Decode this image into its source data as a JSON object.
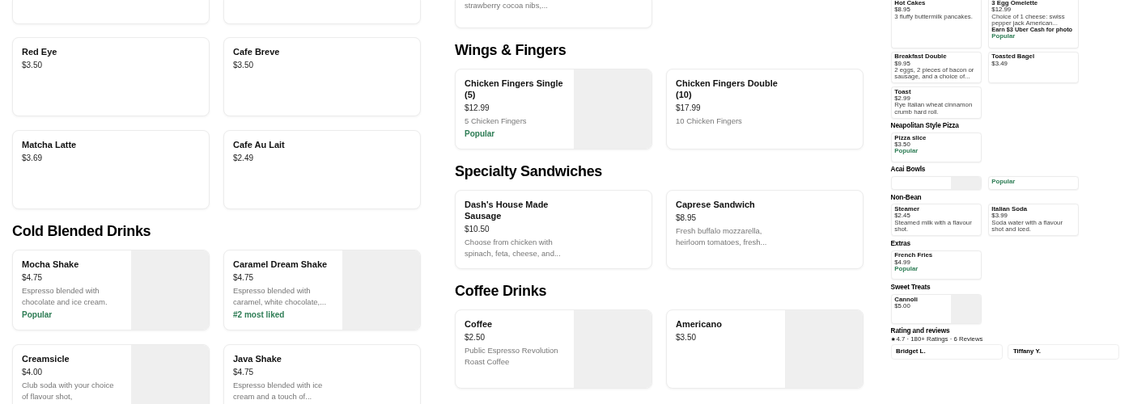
{
  "panels": [
    {
      "kind": "full",
      "blocks": [
        {
          "kind": "stub_row"
        },
        {
          "kind": "row",
          "cards": [
            {
              "name": "Red Eye",
              "price": "$3.50"
            },
            {
              "name": "Cafe Breve",
              "price": "$3.50"
            }
          ]
        },
        {
          "kind": "row",
          "cards": [
            {
              "name": "Matcha Latte",
              "price": "$3.69"
            },
            {
              "name": "Cafe Au Lait",
              "price": "$2.49"
            }
          ]
        },
        {
          "kind": "heading",
          "text": "Cold Blended Drinks"
        },
        {
          "kind": "row",
          "cards": [
            {
              "name": "Mocha Shake",
              "price": "$4.75",
              "description": "Espresso blended with chocolate and ice cream.",
              "badges": [
                {
                  "kind": "popular",
                  "text": "Popular"
                }
              ],
              "image": true
            },
            {
              "name": "Caramel Dream Shake",
              "price": "$4.75",
              "description": "Espresso blended with caramel, white chocolate,...",
              "badges": [
                {
                  "kind": "popular",
                  "text": "#2 most liked"
                }
              ],
              "image": true
            }
          ]
        },
        {
          "kind": "row",
          "cards": [
            {
              "name": "Creamsicle",
              "price": "$4.00",
              "description": "Club soda with your choice of flavour shot,",
              "image": true
            },
            {
              "name": "Java Shake",
              "price": "$4.75",
              "description": "Espresso blended with ice cream and a touch of..."
            }
          ]
        }
      ]
    },
    {
      "kind": "full",
      "blocks": [
        {
          "kind": "row",
          "cards": [
            {
              "description": "strawberry cocoa nibs,..."
            }
          ]
        },
        {
          "kind": "heading",
          "text": "Wings & Fingers"
        },
        {
          "kind": "row",
          "cards": [
            {
              "name": "Chicken Fingers Single (5)",
              "price": "$12.99",
              "description": "5 Chicken Fingers",
              "badges": [
                {
                  "kind": "popular",
                  "text": "Popular"
                }
              ],
              "image": true
            },
            {
              "name": "Chicken Fingers Double (10)",
              "price": "$17.99",
              "description": "10 Chicken Fingers"
            }
          ]
        },
        {
          "kind": "heading",
          "text": "Specialty Sandwiches"
        },
        {
          "kind": "row",
          "cards": [
            {
              "name": "Dash's House Made Sausage",
              "price": "$10.50",
              "description": "Choose from chicken with spinach, feta, cheese, and..."
            },
            {
              "name": "Caprese Sandwich",
              "price": "$8.95",
              "description": "Fresh buffalo mozzarella, heirloom tomatoes, fresh..."
            }
          ]
        },
        {
          "kind": "heading",
          "text": "Coffee Drinks"
        },
        {
          "kind": "row",
          "cards": [
            {
              "name": "Coffee",
              "price": "$2.50",
              "description": "Public Espresso Revolution Roast Coffee",
              "image": true
            },
            {
              "name": "Americano",
              "price": "$3.50",
              "image": true
            }
          ]
        }
      ]
    },
    {
      "kind": "mini",
      "blocks": [
        {
          "kind": "row",
          "cards": [
            {
              "name": "Hot Cakes",
              "price": "$8.95",
              "description": "3 fluffy buttermilk pancakes."
            },
            {
              "name": "3 Egg Omelette",
              "price": "$12.99",
              "description": "Choice of 1 cheese: swiss pepper jack American...",
              "badges": [
                {
                  "kind": "promo",
                  "text": "Earn $3 Uber Cash for photo"
                },
                {
                  "kind": "popular",
                  "text": "Popular"
                }
              ]
            }
          ]
        },
        {
          "kind": "row",
          "cards": [
            {
              "name": "Breakfast Double",
              "price": "$9.95",
              "description": "2 eggs, 2 pieces of bacon or sausage, and a choice of..."
            },
            {
              "name": "Toasted Bagel",
              "price": "$3.49"
            }
          ]
        },
        {
          "kind": "row",
          "cards": [
            {
              "name": "Toast",
              "price": "$2.99",
              "description": "Rye Italian wheat cinnamon crumb hard roll."
            }
          ]
        },
        {
          "kind": "heading",
          "text": "Neapolitan Style Pizza"
        },
        {
          "kind": "row",
          "cards": [
            {
              "name": "Pizza slice",
              "price": "$3.50",
              "badges": [
                {
                  "kind": "popular",
                  "text": "Popular"
                }
              ]
            }
          ]
        },
        {
          "kind": "heading",
          "text": "Acai Bowls"
        },
        {
          "kind": "row",
          "cards": [
            {
              "image": true
            },
            {
              "badges": [
                {
                  "kind": "popular",
                  "text": "Popular"
                }
              ]
            }
          ]
        },
        {
          "kind": "heading",
          "text": "Non-Bean"
        },
        {
          "kind": "row",
          "cards": [
            {
              "name": "Steamer",
              "price": "$2.45",
              "description": "Steamed milk with a flavour shot."
            },
            {
              "name": "Italian Soda",
              "price": "$3.99",
              "description": "Soda water with a flavour shot and iced."
            }
          ]
        },
        {
          "kind": "heading",
          "text": "Extras"
        },
        {
          "kind": "row",
          "cards": [
            {
              "name": "French Fries",
              "price": "$4.99",
              "badges": [
                {
                  "kind": "popular",
                  "text": "Popular"
                }
              ]
            }
          ]
        },
        {
          "kind": "heading",
          "text": "Sweet Treats"
        },
        {
          "kind": "row",
          "cards": [
            {
              "name": "Cannoli",
              "price": "$5.00",
              "image": true
            }
          ]
        },
        {
          "kind": "reviews",
          "heading": "Rating and reviews",
          "summary": "4.7 · 180+ Ratings · 6 Reviews",
          "reviewers": [
            "Bridget L.",
            "Tiffany Y."
          ]
        }
      ]
    }
  ]
}
